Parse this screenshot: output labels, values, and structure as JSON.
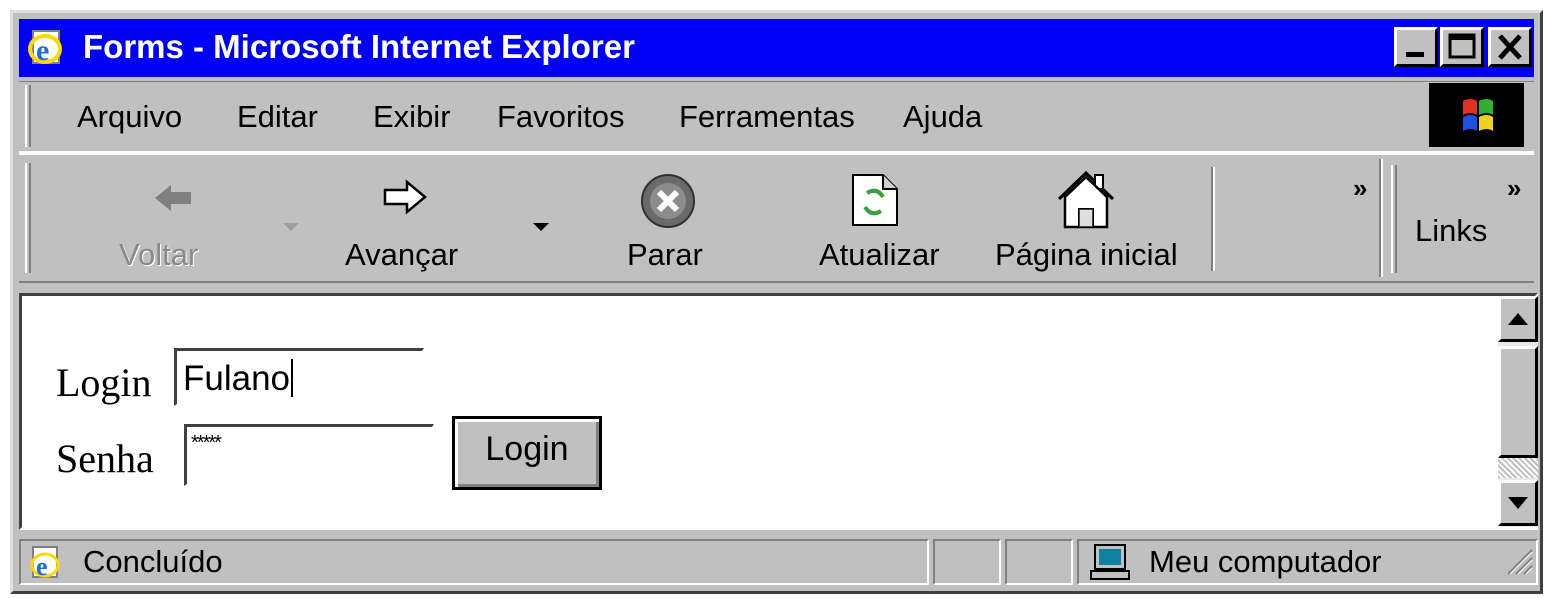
{
  "window": {
    "title": "Forms - Microsoft Internet Explorer",
    "minimize_icon": "minimize-icon",
    "maximize_icon": "maximize-icon",
    "close_icon": "close-icon"
  },
  "menu": {
    "items": [
      {
        "label": "Arquivo"
      },
      {
        "label": "Editar"
      },
      {
        "label": "Exibir"
      },
      {
        "label": "Favoritos"
      },
      {
        "label": "Ferramentas"
      },
      {
        "label": "Ajuda"
      }
    ]
  },
  "toolbar": {
    "back": "Voltar",
    "forward": "Avançar",
    "stop": "Parar",
    "refresh": "Atualizar",
    "home": "Página inicial",
    "more": "»",
    "links_more": "»",
    "links": "Links"
  },
  "form": {
    "login_label": "Login",
    "login_value": "Fulano",
    "password_label": "Senha",
    "password_value": "*****",
    "submit_label": "Login"
  },
  "status": {
    "text": "Concluído",
    "zone": "Meu computador"
  },
  "colors": {
    "titlebar": "#0000f8",
    "chrome": "#c0c0c0"
  }
}
